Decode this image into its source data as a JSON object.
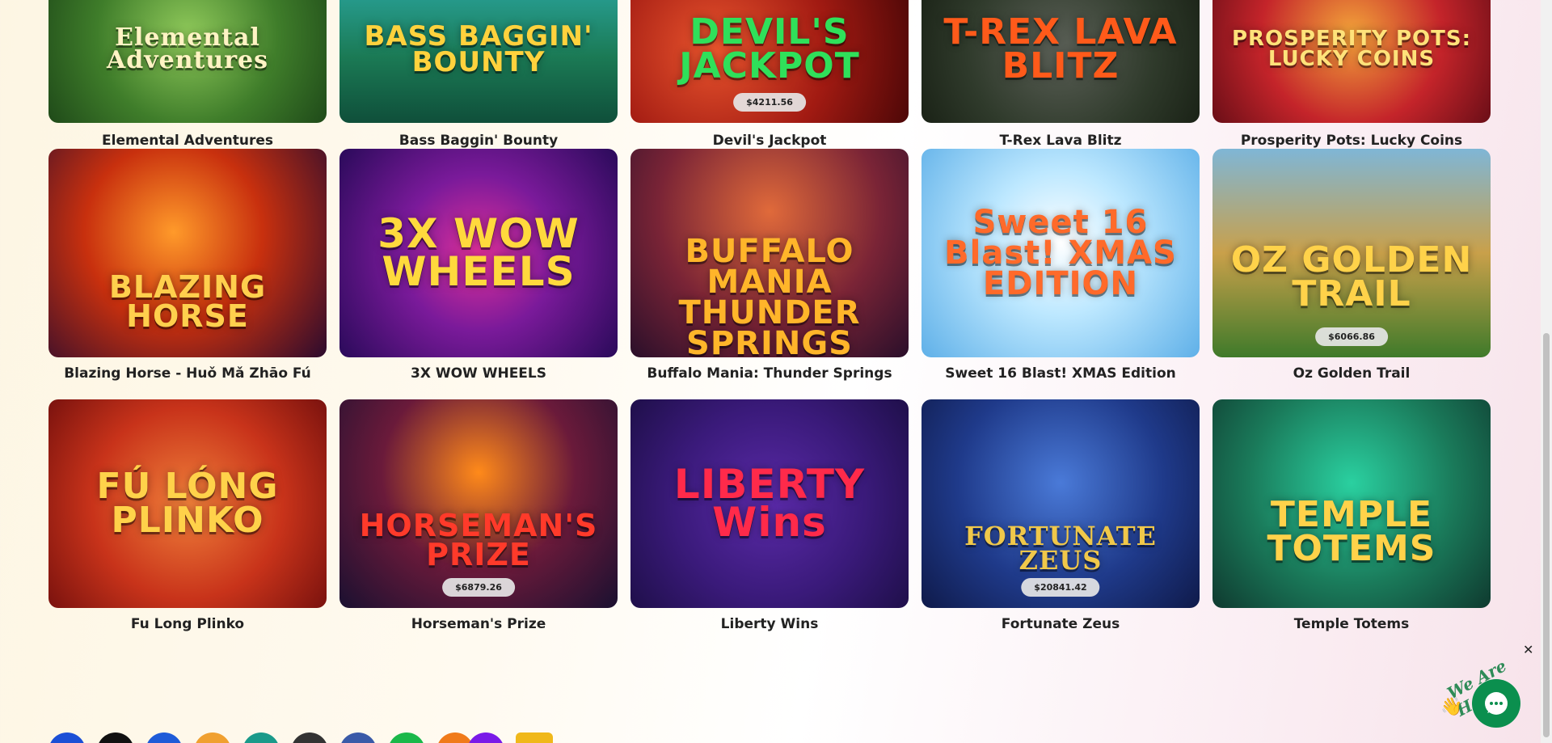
{
  "games": [
    {
      "name": "Elemental Adventures",
      "art": "Elemental Adventures",
      "jackpot": ""
    },
    {
      "name": "Bass Baggin' Bounty",
      "art": "BASS BAGGIN' BOUNTY",
      "jackpot": ""
    },
    {
      "name": "Devil's Jackpot",
      "art": "DEVIL'S JACKPOT",
      "jackpot": "$4211.56"
    },
    {
      "name": "T-Rex Lava Blitz",
      "art": "T-REX LAVA BLITZ",
      "jackpot": ""
    },
    {
      "name": "Prosperity Pots: Lucky Coins",
      "art": "PROSPERITY POTS: LUCKY COINS",
      "jackpot": ""
    },
    {
      "name": "Blazing Horse - Huǒ Mǎ Zhāo Fú",
      "art": "BLAZING HORSE",
      "jackpot": ""
    },
    {
      "name": "3X WOW WHEELS",
      "art": "3X WOW WHEELS",
      "jackpot": ""
    },
    {
      "name": "Buffalo Mania: Thunder Springs",
      "art": "BUFFALO MANIA THUNDER SPRINGS",
      "jackpot": ""
    },
    {
      "name": "Sweet 16 Blast! XMAS Edition",
      "art": "Sweet 16 Blast! XMAS EDITION",
      "jackpot": ""
    },
    {
      "name": "Oz Golden Trail",
      "art": "OZ GOLDEN TRAIL",
      "jackpot": "$6066.86"
    },
    {
      "name": "Fu Long Plinko",
      "art": "FÚ LÓNG PLINKO",
      "jackpot": ""
    },
    {
      "name": "Horseman's Prize",
      "art": "HORSEMAN'S PRIZE",
      "jackpot": "$6879.26"
    },
    {
      "name": "Liberty Wins",
      "art": "LIBERTY Wins",
      "jackpot": ""
    },
    {
      "name": "Fortunate Zeus",
      "art": "FORTUNATE ZEUS",
      "jackpot": "$20841.42"
    },
    {
      "name": "Temple Totems",
      "art": "TEMPLE TOTEMS",
      "jackpot": ""
    }
  ],
  "chat": {
    "tagline": "We Are Here!",
    "close": "✕",
    "icon": "chat-bubble-icon"
  },
  "colors": {
    "chat_green": "#0b8f4e",
    "text": "#222222"
  }
}
